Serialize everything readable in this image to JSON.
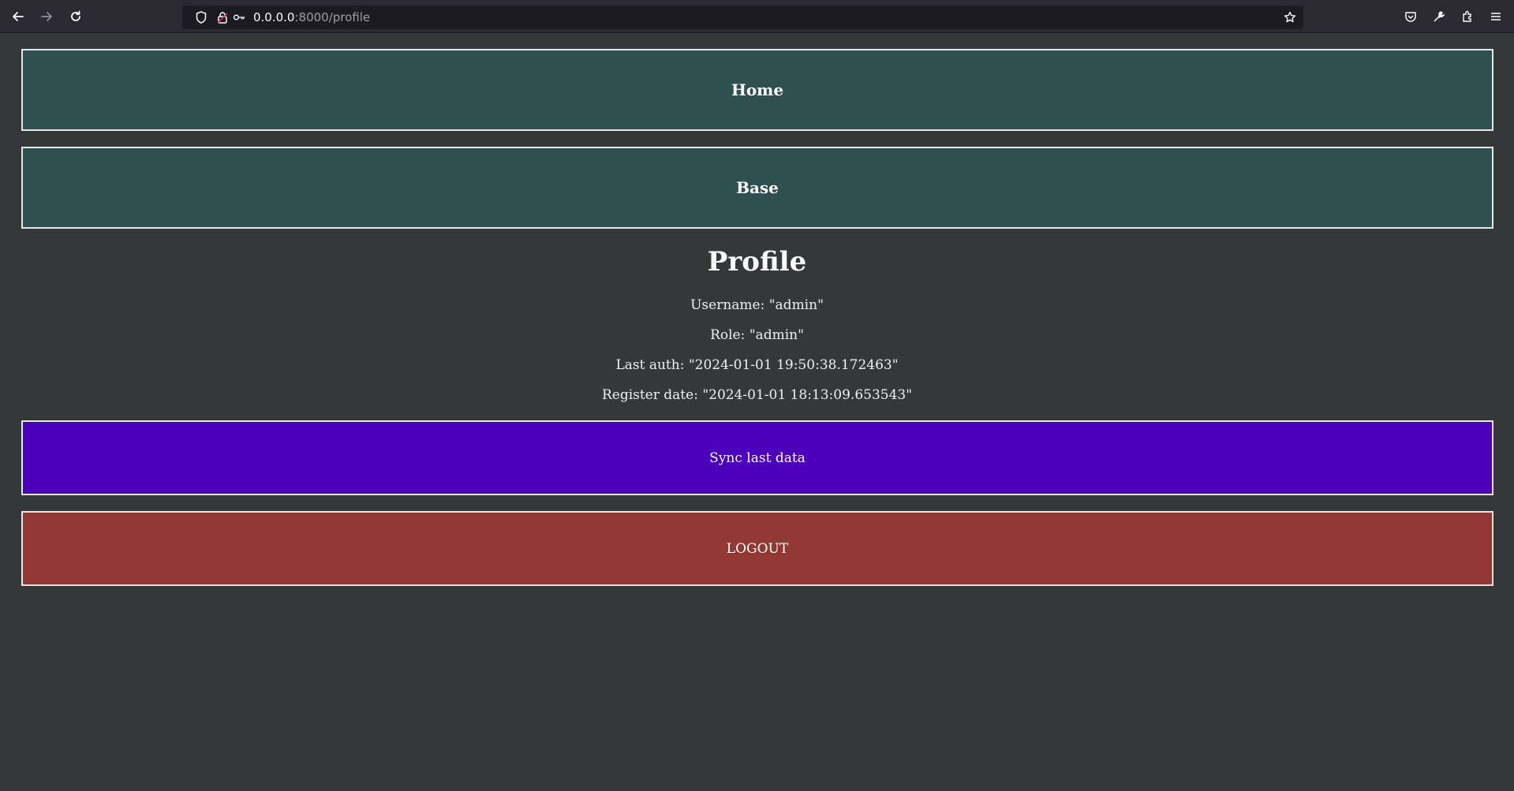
{
  "browser": {
    "url_host": "0.0.0.0",
    "url_rest": ":8000/profile"
  },
  "nav": {
    "home_label": "Home",
    "base_label": "Base"
  },
  "profile": {
    "title": "Profile",
    "username_line": "Username: \"admin\"",
    "role_line": "Role: \"admin\"",
    "last_auth_line": "Last auth: \"2024-01-01 19:50:38.172463\"",
    "register_date_line": "Register date: \"2024-01-01 18:13:09.653543\""
  },
  "actions": {
    "sync_label": "Sync last data",
    "logout_label": "LOGOUT"
  },
  "colors": {
    "page_bg": "#343839",
    "nav_bg": "#2f5051",
    "sync_bg": "#4b00b9",
    "logout_bg": "#923834"
  }
}
